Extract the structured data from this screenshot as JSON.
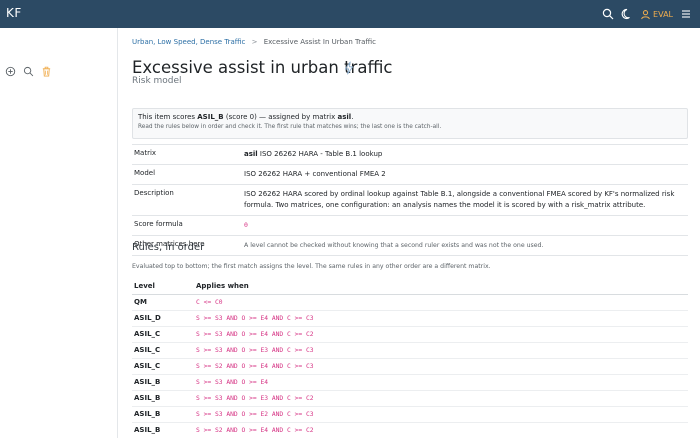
{
  "app": {
    "brand": "KF",
    "user_label": "EVAL"
  },
  "icons": {
    "search": "search-icon",
    "theme": "moon-icon",
    "user": "user-icon",
    "menu": "menu-icon",
    "add": "add-circle-icon",
    "find": "search-icon",
    "delete": "trash-icon",
    "title": "lightning-bolt-icon"
  },
  "colors": {
    "topbar": "#2c4a64",
    "accent": "#f0ad4e",
    "code": "#d63384",
    "link": "#2c6fa5"
  },
  "breadcrumb": {
    "parent": "Urban, Low Speed, Dense Traffic",
    "separator": ">",
    "current": "Excessive Assist In Urban Traffic"
  },
  "page": {
    "title": "Excessive assist in urban traffic",
    "subtitle": "Risk model"
  },
  "notice": {
    "prefix": "This item scores ",
    "level": "ASIL_B",
    "middle": " (score 0) — assigned by matrix ",
    "matrix": "asil",
    "suffix": ".",
    "detail": "Read the rules below in order and check it. The first rule that matches wins; the last one is the catch-all."
  },
  "info": {
    "matrix_label": "Matrix",
    "matrix_code": "asil",
    "matrix_value": " ISO 26262 HARA - Table B.1 lookup",
    "model_label": "Model",
    "model_value": "ISO 26262 HARA + conventional FMEA 2",
    "description_label": "Description",
    "description_value": "ISO 26262 HARA scored by ordinal lookup against Table B.1, alongside a conventional FMEA scored by KF's normalized risk formula. Two matrices, one configuration: an analysis names the model it is scored by with a risk_matrix attribute.",
    "formula_label": "Score formula",
    "formula_value": "0",
    "other_label": "Other matrices here",
    "other_value": "A level cannot be checked without knowing that a second ruler exists and was not the one used."
  },
  "rules": {
    "heading": "Rules, in order",
    "note": "Evaluated top to bottom; the first match assigns the level. The same rules in any other order are a different matrix.",
    "col_level": "Level",
    "col_applies": "Applies when",
    "rows": [
      {
        "level": "QM",
        "condition": "C <= C0"
      },
      {
        "level": "ASIL_D",
        "condition": "S >= S3 AND O >= E4 AND C >= C3"
      },
      {
        "level": "ASIL_C",
        "condition": "S >= S3 AND O >= E4 AND C >= C2"
      },
      {
        "level": "ASIL_C",
        "condition": "S >= S3 AND O >= E3 AND C >= C3"
      },
      {
        "level": "ASIL_C",
        "condition": "S >= S2 AND O >= E4 AND C >= C3"
      },
      {
        "level": "ASIL_B",
        "condition": "S >= S3 AND O >= E4"
      },
      {
        "level": "ASIL_B",
        "condition": "S >= S3 AND O >= E3 AND C >= C2"
      },
      {
        "level": "ASIL_B",
        "condition": "S >= S3 AND O >= E2 AND C >= C3"
      },
      {
        "level": "ASIL_B",
        "condition": "S >= S2 AND O >= E4 AND C >= C2"
      }
    ]
  }
}
